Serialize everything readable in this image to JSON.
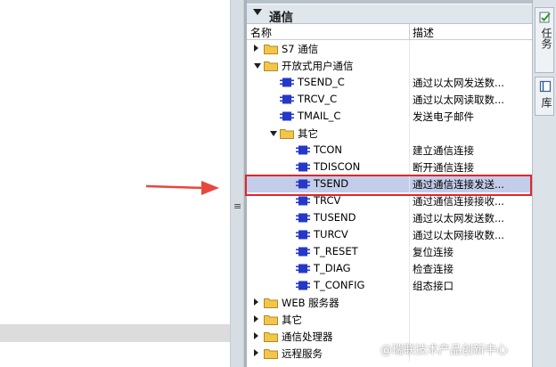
{
  "section": {
    "title": "通信"
  },
  "columns": {
    "name": "名称",
    "description": "描述"
  },
  "tree": [
    {
      "kind": "folder",
      "level": 0,
      "expanded": false,
      "label": "S7 通信",
      "desc": ""
    },
    {
      "kind": "folder",
      "level": 0,
      "expanded": true,
      "label": "开放式用户通信",
      "desc": ""
    },
    {
      "kind": "block",
      "level": 1,
      "label": "TSEND_C",
      "desc": "通过以太网发送数..."
    },
    {
      "kind": "block",
      "level": 1,
      "label": "TRCV_C",
      "desc": "通过以太网读取数..."
    },
    {
      "kind": "block",
      "level": 1,
      "label": "TMAIL_C",
      "desc": "发送电子邮件"
    },
    {
      "kind": "folder",
      "level": 1,
      "expanded": true,
      "label": "其它",
      "desc": ""
    },
    {
      "kind": "block",
      "level": 2,
      "label": "TCON",
      "desc": "建立通信连接"
    },
    {
      "kind": "block",
      "level": 2,
      "label": "TDISCON",
      "desc": "断开通信连接"
    },
    {
      "kind": "block",
      "level": 2,
      "label": "TSEND",
      "desc": "通过通信连接发送...",
      "selected": true
    },
    {
      "kind": "block",
      "level": 2,
      "label": "TRCV",
      "desc": "通过通信连接接收..."
    },
    {
      "kind": "block",
      "level": 2,
      "label": "TUSEND",
      "desc": "通过以太网发送数..."
    },
    {
      "kind": "block",
      "level": 2,
      "label": "TURCV",
      "desc": "通过以太网接收数..."
    },
    {
      "kind": "block",
      "level": 2,
      "label": "T_RESET",
      "desc": "复位连接"
    },
    {
      "kind": "block",
      "level": 2,
      "label": "T_DIAG",
      "desc": "检查连接"
    },
    {
      "kind": "block",
      "level": 2,
      "label": "T_CONFIG",
      "desc": "组态接口"
    },
    {
      "kind": "folder",
      "level": 0,
      "expanded": false,
      "label": "WEB 服务器",
      "desc": ""
    },
    {
      "kind": "folder",
      "level": 0,
      "expanded": false,
      "label": "其它",
      "desc": ""
    },
    {
      "kind": "folder",
      "level": 0,
      "expanded": false,
      "label": "通信处理器",
      "desc": ""
    },
    {
      "kind": "folder",
      "level": 0,
      "expanded": false,
      "label": "远程服务",
      "desc": ""
    }
  ],
  "right_tabs": [
    {
      "label": "任务",
      "icon": "task-check-icon"
    },
    {
      "label": "库",
      "icon": "library-book-icon"
    }
  ],
  "watermark": "@瑞联技术产品创新中心",
  "colors": {
    "selection": "#c3cde9",
    "highlight_border": "#e0262a",
    "arrow": "#e8473b",
    "block_icon": "#2538c8",
    "folder": "#f3c64a"
  }
}
